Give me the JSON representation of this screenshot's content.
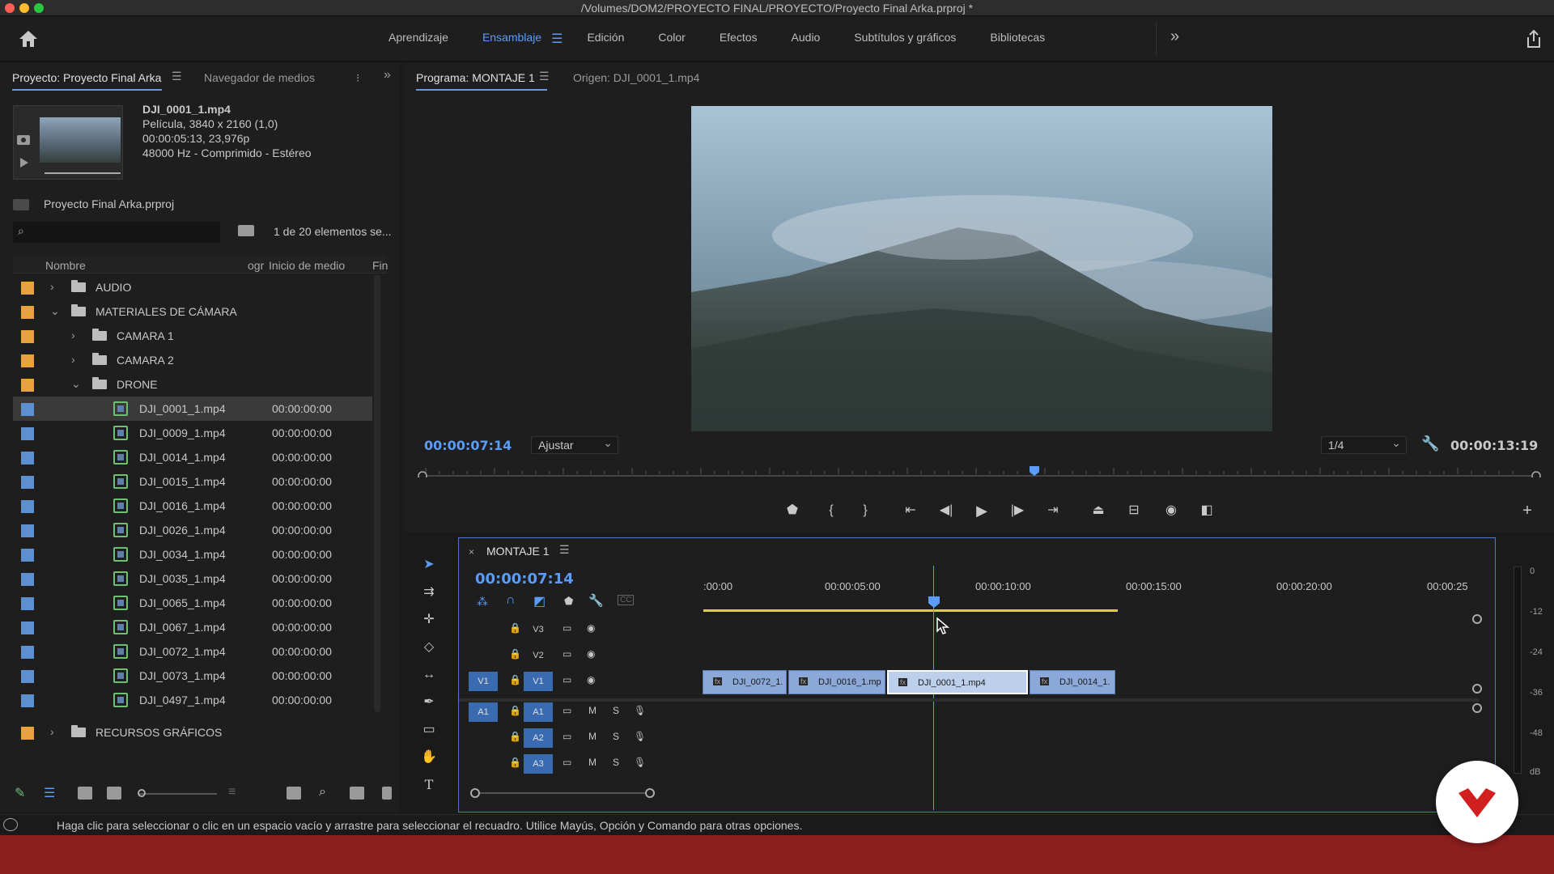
{
  "window": {
    "title": "/Volumes/DOM2/PROYECTO FINAL/PROYECTO/Proyecto Final Arka.prproj *"
  },
  "workspaces": {
    "items": [
      "Aprendizaje",
      "Ensamblaje",
      "Edición",
      "Color",
      "Efectos",
      "Audio",
      "Subtítulos y gráficos",
      "Bibliotecas"
    ],
    "active": "Ensamblaje",
    "more_glyph": "»"
  },
  "project_panel": {
    "tab_project": "Proyecto: Proyecto Final Arka",
    "tab_media": "Navegador de medios",
    "clip_info": {
      "name": "DJI_0001_1.mp4",
      "line1": "Película, 3840 x 2160 (1,0)",
      "line2": "00:00:05:13, 23,976p",
      "line3": "48000 Hz - Comprimido - Estéreo"
    },
    "project_file": "Proyecto Final Arka.prproj",
    "search_placeholder": "",
    "selection_count": "1 de 20 elementos se...",
    "columns": {
      "name": "Nombre",
      "ogr": "ogr",
      "media_start": "Inicio de medio",
      "fin": "Fin"
    },
    "folders": {
      "audio": "AUDIO",
      "camera_materials": "MATERIALES DE CÁMARA",
      "camera1": "CAMARA 1",
      "camera2": "CAMARA 2",
      "drone": "DRONE",
      "graphics": "RECURSOS GRÁFICOS"
    },
    "clips": [
      {
        "name": "DJI_0001_1.mp4",
        "start": "00:00:00:00"
      },
      {
        "name": "DJI_0009_1.mp4",
        "start": "00:00:00:00"
      },
      {
        "name": "DJI_0014_1.mp4",
        "start": "00:00:00:00"
      },
      {
        "name": "DJI_0015_1.mp4",
        "start": "00:00:00:00"
      },
      {
        "name": "DJI_0016_1.mp4",
        "start": "00:00:00:00"
      },
      {
        "name": "DJI_0026_1.mp4",
        "start": "00:00:00:00"
      },
      {
        "name": "DJI_0034_1.mp4",
        "start": "00:00:00:00"
      },
      {
        "name": "DJI_0035_1.mp4",
        "start": "00:00:00:00"
      },
      {
        "name": "DJI_0065_1.mp4",
        "start": "00:00:00:00"
      },
      {
        "name": "DJI_0067_1.mp4",
        "start": "00:00:00:00"
      },
      {
        "name": "DJI_0072_1.mp4",
        "start": "00:00:00:00"
      },
      {
        "name": "DJI_0073_1.mp4",
        "start": "00:00:00:00"
      },
      {
        "name": "DJI_0497_1.mp4",
        "start": "00:00:00:00"
      }
    ]
  },
  "program_monitor": {
    "tab_program": "Programa: MONTAJE 1",
    "tab_source": "Origen: DJI_0001_1.mp4",
    "current_time": "00:00:07:14",
    "fit": "Ajustar",
    "resolution": "1/4",
    "duration": "00:00:13:19"
  },
  "timeline": {
    "sequence_name": "MONTAJE 1",
    "current_time": "00:00:07:14",
    "ruler_labels": [
      ":00:00",
      "00:00:05:00",
      "00:00:10:00",
      "00:00:15:00",
      "00:00:20:00",
      "00:00:25"
    ],
    "video_tracks": [
      "V3",
      "V2",
      "V1"
    ],
    "audio_tracks": [
      "A1",
      "A2",
      "A3"
    ],
    "source_v1": "V1",
    "source_a1": "A1",
    "mute": "M",
    "solo": "S",
    "clips": [
      "DJI_0072_1.",
      "DJI_0016_1.mp",
      "DJI_0001_1.mp4",
      "DJI_0014_1."
    ]
  },
  "audio_meter": {
    "labels": [
      "0",
      "-12",
      "-24",
      "-36",
      "-48",
      "dB"
    ]
  },
  "status": {
    "text": "Haga clic para seleccionar o clic en un espacio vacío y arrastre para seleccionar el recuadro. Utilice Mayús, Opción y Comando para otras opciones."
  },
  "colors": {
    "accent": "#5a9cf8",
    "folder_swatch": "#e8a33c",
    "clip_swatch": "#5e8fd0",
    "clip_fill": "#8ba8d8",
    "work_area": "#e0d030",
    "brand_red": "#c81e1e"
  }
}
